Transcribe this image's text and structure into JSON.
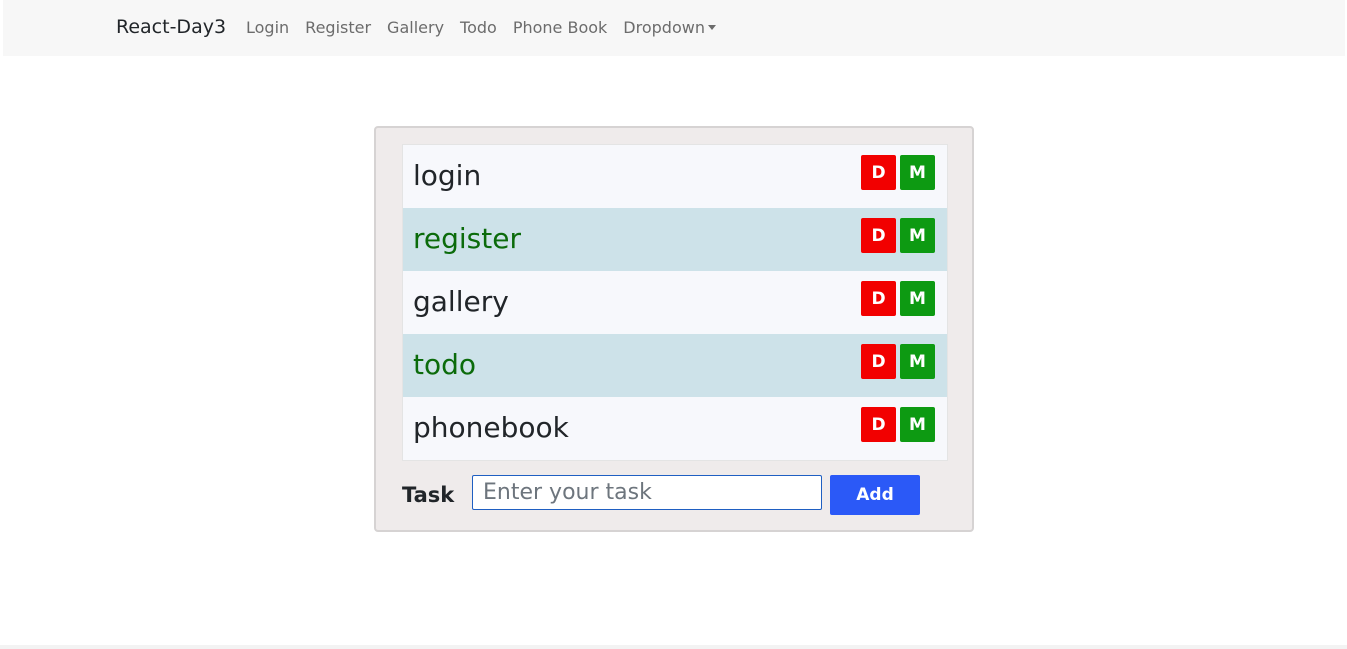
{
  "navbar": {
    "brand": "React-Day3",
    "links": [
      "Login",
      "Register",
      "Gallery",
      "Todo",
      "Phone Book"
    ],
    "dropdown_label": "Dropdown"
  },
  "tasks": [
    {
      "label": "login"
    },
    {
      "label": "register"
    },
    {
      "label": "gallery"
    },
    {
      "label": "todo"
    },
    {
      "label": "phonebook"
    }
  ],
  "item_buttons": {
    "delete_label": "D",
    "modify_label": "M"
  },
  "form": {
    "label": "Task",
    "placeholder": "Enter your task",
    "value": "",
    "add_label": "Add"
  },
  "colors": {
    "delete": "#f20000",
    "modify": "#0d9a12",
    "add": "#2b59f7",
    "alt_row_bg": "#cde2e9",
    "alt_row_text": "#0b6b0b"
  }
}
